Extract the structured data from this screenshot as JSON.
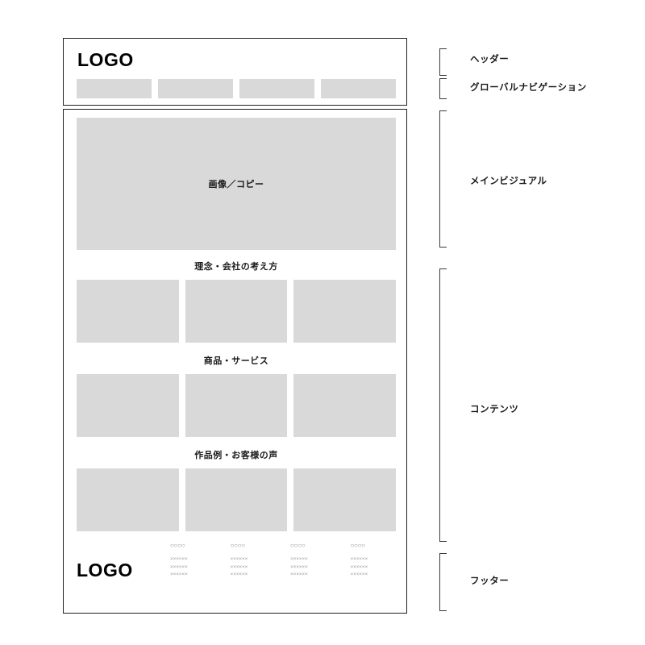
{
  "page": {
    "title_logo": "LOGO",
    "footer_logo": "LOGO"
  },
  "header": {
    "logo": "LOGO"
  },
  "global_nav": {
    "items": [
      {
        "label": ""
      },
      {
        "label": ""
      },
      {
        "label": ""
      },
      {
        "label": ""
      }
    ]
  },
  "main_visual": {
    "label": "画像／コピー"
  },
  "content": {
    "sections": [
      {
        "title": "理念・会社の考え方",
        "cards": [
          {
            "label": ""
          },
          {
            "label": ""
          },
          {
            "label": ""
          }
        ]
      },
      {
        "title": "商品・サービス",
        "cards": [
          {
            "label": ""
          },
          {
            "label": ""
          },
          {
            "label": ""
          }
        ]
      },
      {
        "title": "作品例・お客様の声",
        "cards": [
          {
            "label": ""
          },
          {
            "label": ""
          },
          {
            "label": ""
          }
        ]
      }
    ]
  },
  "footer": {
    "logo": "LOGO",
    "columns": [
      {
        "heading": "○○○○",
        "lines": [
          "××××××",
          "××××××",
          "××××××"
        ]
      },
      {
        "heading": "○○○○",
        "lines": [
          "××××××",
          "××××××",
          "××××××"
        ]
      },
      {
        "heading": "○○○○",
        "lines": [
          "××××××",
          "××××××",
          "××××××"
        ]
      },
      {
        "heading": "○○○○",
        "lines": [
          "××××××",
          "××××××",
          "××××××"
        ]
      }
    ]
  },
  "annotations": [
    {
      "label": "ヘッダー"
    },
    {
      "label": "グローバルナビゲーション"
    },
    {
      "label": "メインビジュアル"
    },
    {
      "label": "コンテンツ"
    },
    {
      "label": "フッター"
    }
  ],
  "colors": {
    "placeholder_gray": "#d9d9d9",
    "frame_border": "#231f20",
    "text": "#1a1a1a",
    "background": "#ffffff"
  }
}
